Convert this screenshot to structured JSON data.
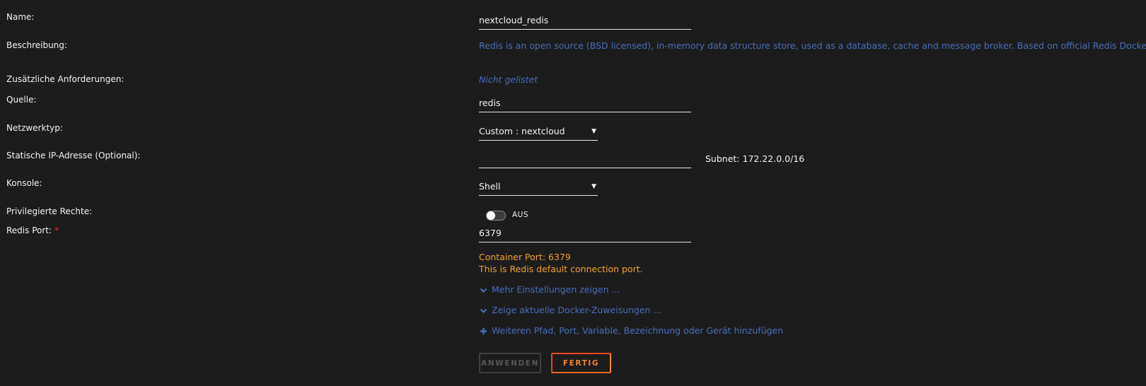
{
  "fields": {
    "name": {
      "label": "Name:",
      "value": "nextcloud_redis"
    },
    "description": {
      "label": "Beschreibung:",
      "value": "Redis is an open source (BSD licensed), in-memory data structure store, used as a database, cache and message broker. Based on official Redis Docker image."
    },
    "requirements": {
      "label": "Zusätzliche Anforderungen:",
      "value": "Nicht gelistet"
    },
    "source": {
      "label": "Quelle:",
      "value": "redis"
    },
    "network": {
      "label": "Netzwerktyp:",
      "value": "Custom : nextcloud"
    },
    "static_ip": {
      "label": "Statische IP-Adresse (Optional):",
      "value": "",
      "subnet": "Subnet: 172.22.0.0/16"
    },
    "console": {
      "label": "Konsole:",
      "value": "Shell"
    },
    "privileged": {
      "label": "Privilegierte Rechte:",
      "state": "AUS",
      "on": false
    },
    "redis_port": {
      "label": "Redis Port:",
      "required_marker": "*",
      "value": "6379",
      "container_port": "Container Port: 6379",
      "hint": "This is Redis default connection port."
    }
  },
  "links": {
    "more_settings": "Mehr Einstellungen zeigen ...",
    "docker_assignments": "Zeige aktuelle Docker-Zuweisungen ...",
    "add_item": "Weiteren Pfad, Port, Variable, Bezeichnung oder Gerät hinzufügen"
  },
  "buttons": {
    "apply": "ANWENDEN",
    "done": "FERTIG"
  },
  "colors": {
    "background": "#1c1c1c",
    "text": "#f2f2f2",
    "link_blue": "#486dba",
    "accent_orange": "#f0a02c",
    "required_red": "#e22828"
  }
}
